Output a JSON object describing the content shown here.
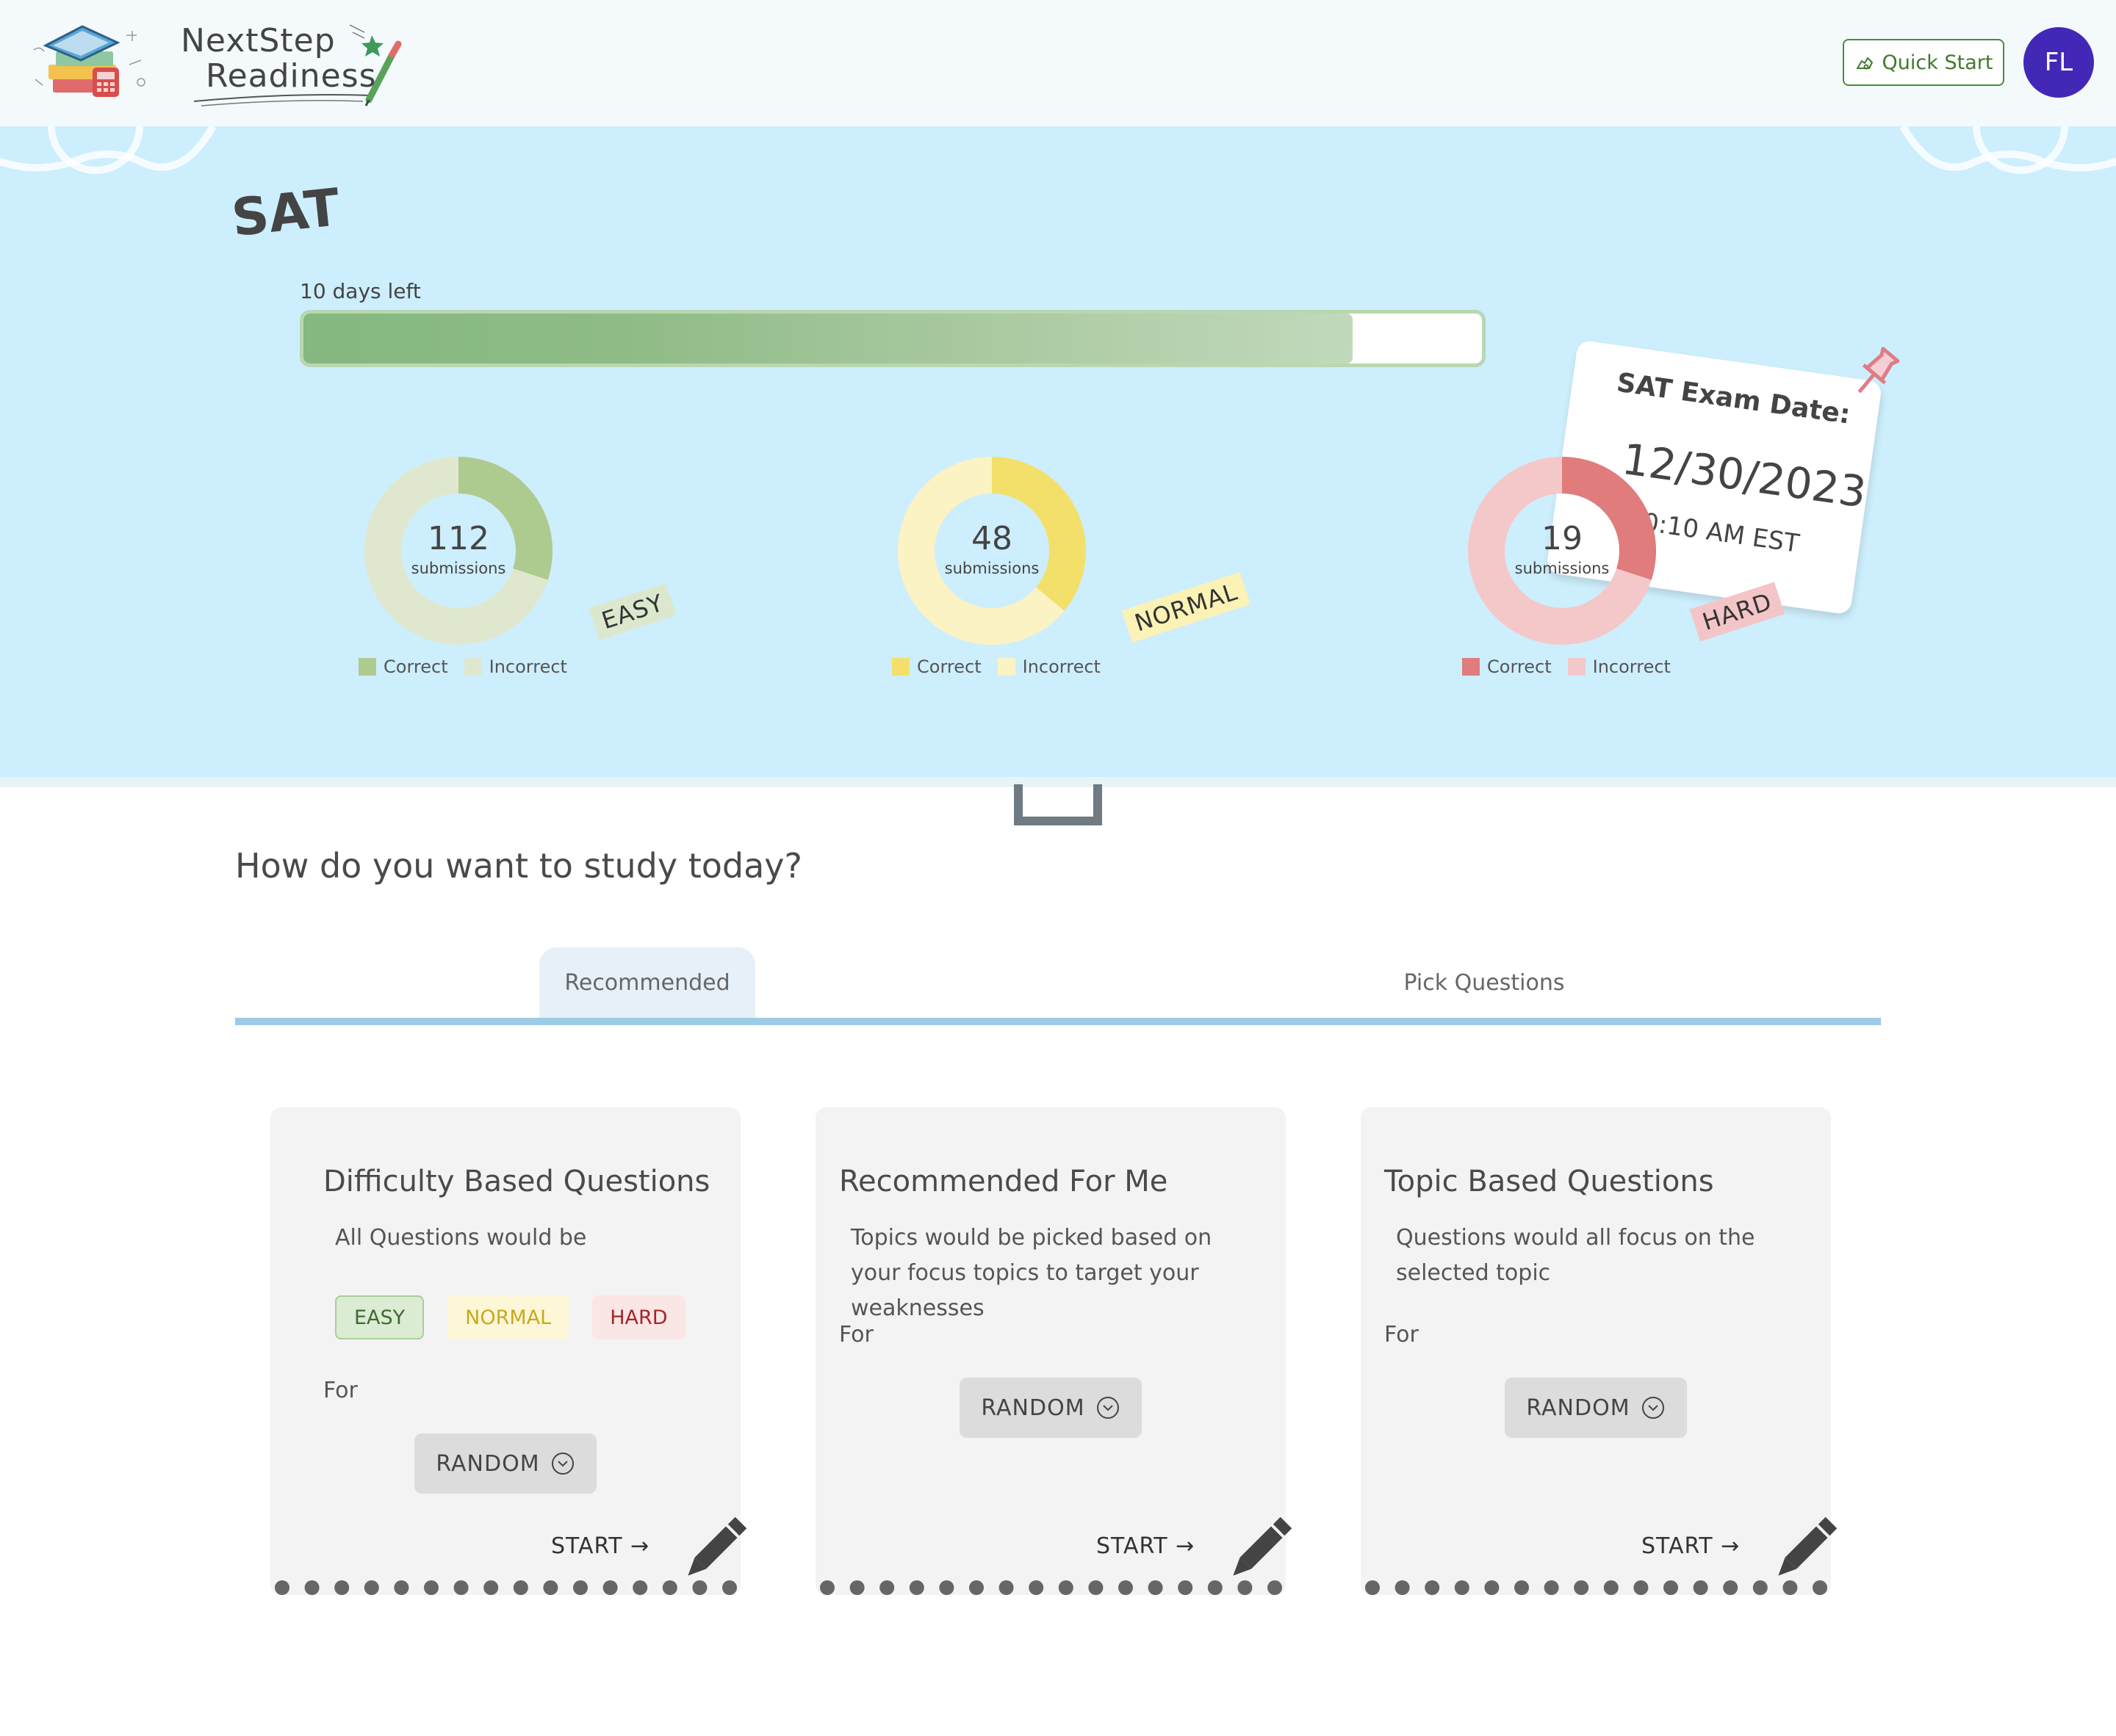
{
  "header": {
    "logo_line1": "NextStep",
    "logo_line2": "Readiness",
    "quick_start_label": "Quick Start",
    "avatar_initials": "FL"
  },
  "exam": {
    "name": "SAT",
    "days_left": "10 days left",
    "progress_fraction": 0.89,
    "date_card": {
      "title": "SAT Exam Date:",
      "date": "12/30/2023",
      "time": "10:10 AM EST"
    }
  },
  "difficulty_stats": [
    {
      "tag": "EASY",
      "count": "112",
      "sub": "submissions",
      "correct_fraction": 0.3,
      "legend_correct": "Correct",
      "legend_incorrect": "Incorrect",
      "color_correct": "#aecb8f",
      "color_incorrect": "#dfe8cf",
      "tag_bg": "#dbe8cd"
    },
    {
      "tag": "NORMAL",
      "count": "48",
      "sub": "submissions",
      "correct_fraction": 0.36,
      "legend_correct": "Correct",
      "legend_incorrect": "Incorrect",
      "color_correct": "#f2e06a",
      "color_incorrect": "#fbf3c3",
      "tag_bg": "#fbf2b6"
    },
    {
      "tag": "HARD",
      "count": "19",
      "sub": "submissions",
      "correct_fraction": 0.3,
      "legend_correct": "Correct",
      "legend_incorrect": "Incorrect",
      "color_correct": "#e07c7c",
      "color_incorrect": "#f4c8c9",
      "tag_bg": "#f3c5c7"
    }
  ],
  "study": {
    "heading": "How do you want to study today?",
    "tabs": [
      "Recommended",
      "Pick Questions"
    ],
    "cards": [
      {
        "title": "Difficulty Based Questions",
        "description": "All Questions would be",
        "pills": [
          "EASY",
          "NORMAL",
          "HARD"
        ],
        "for_label": "For",
        "select_value": "RANDOM",
        "start_label": "START →"
      },
      {
        "title": "Recommended For Me",
        "description": "Topics would be picked based on your focus topics to target your weaknesses",
        "for_label": "For",
        "select_value": "RANDOM",
        "start_label": "START →"
      },
      {
        "title": "Topic Based Questions",
        "description": "Questions would all focus on the selected topic",
        "for_label": "For",
        "select_value": "RANDOM",
        "start_label": "START →"
      }
    ]
  },
  "colors": {
    "hero_bg": "#cdeefc",
    "avatar": "#4327b6",
    "quick_start": "#4d8a3a",
    "tab_line": "#9ccbe6"
  },
  "icons": [
    "books-icon",
    "star-icon",
    "pen-icon",
    "hand-icon",
    "pushpin-icon",
    "chevron-down-circle-icon",
    "pencil-icon"
  ]
}
